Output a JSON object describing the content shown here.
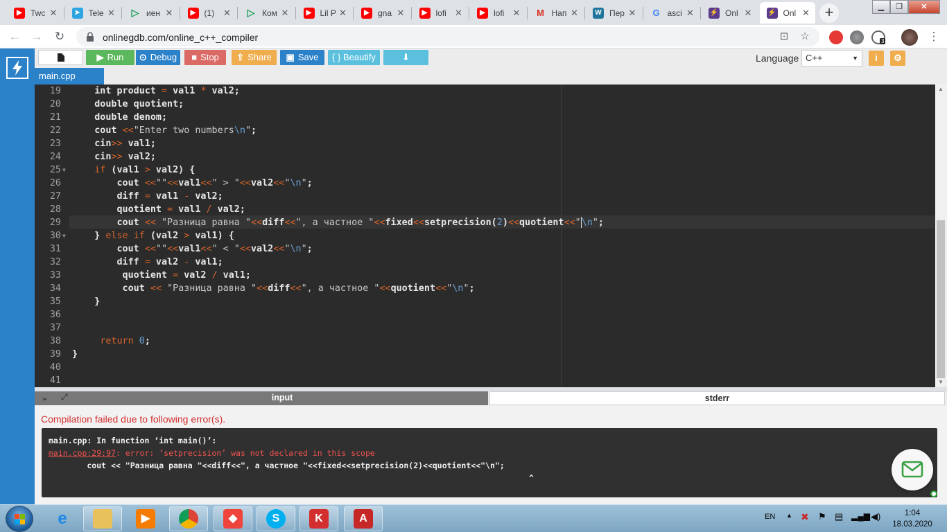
{
  "browser": {
    "tabs": [
      {
        "title": "Twc",
        "favicon": "youtube-icon",
        "color": "#ff0000"
      },
      {
        "title": "Tele",
        "favicon": "telegram-icon",
        "color": "#2ca5e0"
      },
      {
        "title": "иен",
        "favicon": "play-icon",
        "color": "#1a9f57"
      },
      {
        "title": "(1) ",
        "favicon": "youtube-icon",
        "color": "#ff0000"
      },
      {
        "title": "Ком",
        "favicon": "play-icon",
        "color": "#1a9f57"
      },
      {
        "title": "Lil P",
        "favicon": "youtube-icon",
        "color": "#ff0000"
      },
      {
        "title": "gna",
        "favicon": "youtube-icon",
        "color": "#ff0000"
      },
      {
        "title": "lofi",
        "favicon": "youtube-icon",
        "color": "#ff0000"
      },
      {
        "title": "lofi",
        "favicon": "youtube-icon",
        "color": "#ff0000"
      },
      {
        "title": "Нап",
        "favicon": "gmail-icon",
        "color": "#d93025"
      },
      {
        "title": "Пер",
        "favicon": "wordpress-icon",
        "color": "#21759b"
      },
      {
        "title": "asci",
        "favicon": "google-icon",
        "color": "#4285f4"
      },
      {
        "title": "Onl",
        "favicon": "onlinegdb-icon",
        "color": "#5d3b8c"
      },
      {
        "title": "Onl",
        "favicon": "onlinegdb-icon",
        "color": "#5d3b8c"
      }
    ],
    "active_tab_index": 13,
    "url": "onlinegdb.com/online_c++_compiler",
    "extension_badge": "3"
  },
  "gdb": {
    "toolbar": {
      "run": "Run",
      "debug": "Debug",
      "stop": "Stop",
      "share": "Share",
      "save": "Save",
      "beautify": "{ } Beautify",
      "language_label": "Language",
      "language_value": "C++"
    },
    "file_tab": "main.cpp",
    "colors": {
      "run": "#5cb85c",
      "debug": "#2c82c9",
      "stop": "#d9534f",
      "share": "#f0ad4e",
      "save": "#2c82c9",
      "beautify": "#5bc0de",
      "download": "#5bc0de",
      "keyword": "#d8642a"
    },
    "editor_lines": [
      {
        "n": "19",
        "fold": false,
        "html": "    int product <span class='op'>=</span> val1 <span class='op'>*</span> val2;"
      },
      {
        "n": "20",
        "fold": false,
        "html": "    double quotient;"
      },
      {
        "n": "21",
        "fold": false,
        "html": "    double denom;"
      },
      {
        "n": "22",
        "fold": false,
        "html": "    cout <span class='op'>&lt;&lt;</span><span class='str'>\"Enter two numbers<span class='esc'>\\n</span>\"</span>;"
      },
      {
        "n": "23",
        "fold": false,
        "html": "    cin<span class='op'>&gt;&gt;</span> val1;"
      },
      {
        "n": "24",
        "fold": false,
        "html": "    cin<span class='op'>&gt;&gt;</span> val2;"
      },
      {
        "n": "25",
        "fold": true,
        "html": "    <span class='kw'>if</span> (val1 <span class='op'>&gt;</span> val2) {"
      },
      {
        "n": "26",
        "fold": false,
        "html": "        cout <span class='op'>&lt;&lt;</span><span class='str'>\"\"</span><span class='op'>&lt;&lt;</span>val1<span class='op'>&lt;&lt;</span><span class='str'>\" &gt; \"</span><span class='op'>&lt;&lt;</span>val2<span class='op'>&lt;&lt;</span><span class='str'>\"<span class='esc'>\\n</span>\"</span>;"
      },
      {
        "n": "27",
        "fold": false,
        "html": "        diff <span class='op'>=</span> val1 <span class='op'>-</span> val2;"
      },
      {
        "n": "28",
        "fold": false,
        "html": "        quotient <span class='op'>=</span> val1 <span class='op'>/</span> val2;"
      },
      {
        "n": "29",
        "fold": false,
        "html": "        cout <span class='op'>&lt;&lt;</span> <span class='str'>\"Разница равна \"</span><span class='op'>&lt;&lt;</span>diff<span class='op'>&lt;&lt;</span><span class='str'>\", а частное \"</span><span class='op'>&lt;&lt;</span>fixed<span class='op'>&lt;&lt;</span>setprecision(<span class='num'>2</span>)<span class='op'>&lt;&lt;</span>quotient<span class='op'>&lt;&lt;</span><span class='str'>\"<span class='caret'></span><span class='esc'>\\n</span>\"</span>;"
      },
      {
        "n": "30",
        "fold": true,
        "html": "    } <span class='kw'>else if</span> (val2 <span class='op'>&gt;</span> val1) {"
      },
      {
        "n": "31",
        "fold": false,
        "html": "        cout <span class='op'>&lt;&lt;</span><span class='str'>\"\"</span><span class='op'>&lt;&lt;</span>val1<span class='op'>&lt;&lt;</span><span class='str'>\" &lt; \"</span><span class='op'>&lt;&lt;</span>val2<span class='op'>&lt;&lt;</span><span class='str'>\"<span class='esc'>\\n</span>\"</span>;"
      },
      {
        "n": "32",
        "fold": false,
        "html": "        diff <span class='op'>=</span> val2 <span class='op'>-</span> val1;"
      },
      {
        "n": "33",
        "fold": false,
        "html": "         quotient <span class='op'>=</span> val2 <span class='op'>/</span> val1;"
      },
      {
        "n": "34",
        "fold": false,
        "html": "         cout <span class='op'>&lt;&lt;</span> <span class='str'>\"Разница равна \"</span><span class='op'>&lt;&lt;</span>diff<span class='op'>&lt;&lt;</span><span class='str'>\", а частное \"</span><span class='op'>&lt;&lt;</span>quotient<span class='op'>&lt;&lt;</span><span class='str'>\"<span class='esc'>\\n</span>\"</span>;"
      },
      {
        "n": "35",
        "fold": false,
        "html": "    }"
      },
      {
        "n": "36",
        "fold": false,
        "html": ""
      },
      {
        "n": "37",
        "fold": false,
        "html": ""
      },
      {
        "n": "38",
        "fold": false,
        "html": "     <span class='kw'>return</span> <span class='num'>0</span>;"
      },
      {
        "n": "39",
        "fold": false,
        "html": "}"
      },
      {
        "n": "40",
        "fold": false,
        "html": ""
      },
      {
        "n": "41",
        "fold": false,
        "html": ""
      }
    ],
    "panel": {
      "input_tab": "input",
      "stderr_tab": "stderr",
      "fail_message": "Compilation failed due to following error(s).",
      "error_in_function": "main.cpp: In function ‘int main()’:",
      "error_location": "main.cpp:29:97",
      "error_text": ": error: ‘setprecision’ was not declared in this scope",
      "error_source": "        cout << \"Разница равна \"<<diff<<\", а частное \"<<fixed<<setprecision(2)<<quotient<<\"\\n\";",
      "error_caret": "^"
    }
  },
  "taskbar": {
    "language": "EN",
    "time": "1:04",
    "date": "18.03.2020",
    "apps": [
      "ie-icon",
      "explorer-icon",
      "media-player-icon",
      "chrome-icon",
      "anydesk-icon",
      "skype-icon",
      "kaspersky-icon",
      "acrobat-icon"
    ]
  }
}
